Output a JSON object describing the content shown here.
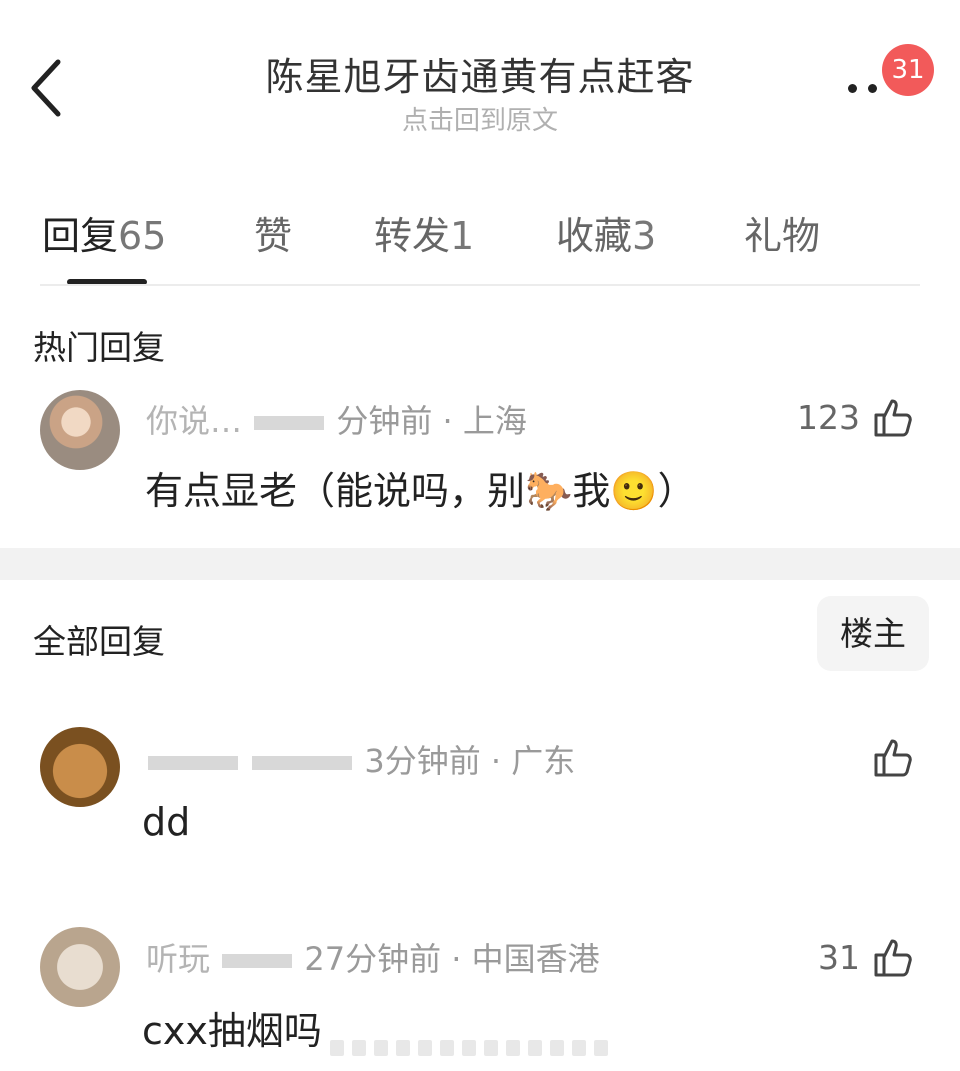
{
  "header": {
    "title": "陈星旭牙齿通黄有点赶客",
    "subtitle": "点击回到原文",
    "badge_count": "31",
    "back_icon": "chevron-left-icon",
    "more_icon": "more-dots-icon"
  },
  "tabs": [
    {
      "label": "回复",
      "count": "65"
    },
    {
      "label": "赞",
      "count": ""
    },
    {
      "label": "转发",
      "count": "1"
    },
    {
      "label": "收藏",
      "count": "3"
    },
    {
      "label": "礼物",
      "count": ""
    }
  ],
  "hot_section": {
    "title": "热门回复",
    "comment": {
      "username": "你说…",
      "time_location": "分钟前 · 上海",
      "text": "有点显老（能说吗，别🐎我🙂）",
      "likes": "123"
    }
  },
  "all_section": {
    "title": "全部回复",
    "owner_button": "楼主",
    "comments": [
      {
        "username": "",
        "time_location": "3分钟前 · 广东",
        "text": "dd",
        "likes": ""
      },
      {
        "username": "听玩",
        "time_location": "27分钟前 · 中国香港",
        "text": "cxx抽烟吗",
        "likes": "31"
      }
    ]
  },
  "colors": {
    "badge": "#f25a5a",
    "text": "#222222",
    "muted": "#9a9a9a"
  }
}
